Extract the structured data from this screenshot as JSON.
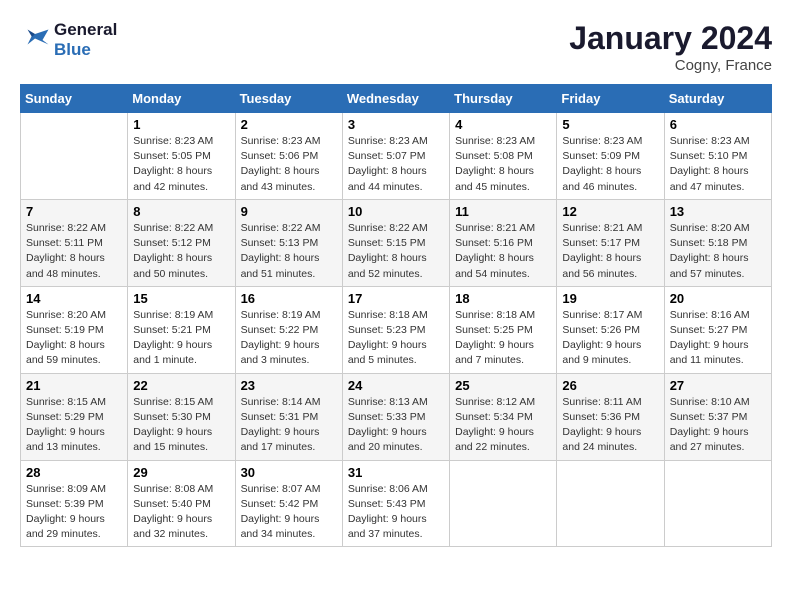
{
  "logo": {
    "text_general": "General",
    "text_blue": "Blue"
  },
  "title": "January 2024",
  "location": "Cogny, France",
  "days_of_week": [
    "Sunday",
    "Monday",
    "Tuesday",
    "Wednesday",
    "Thursday",
    "Friday",
    "Saturday"
  ],
  "weeks": [
    [
      {
        "day": null,
        "info": null
      },
      {
        "day": "1",
        "info": "Sunrise: 8:23 AM\nSunset: 5:05 PM\nDaylight: 8 hours\nand 42 minutes."
      },
      {
        "day": "2",
        "info": "Sunrise: 8:23 AM\nSunset: 5:06 PM\nDaylight: 8 hours\nand 43 minutes."
      },
      {
        "day": "3",
        "info": "Sunrise: 8:23 AM\nSunset: 5:07 PM\nDaylight: 8 hours\nand 44 minutes."
      },
      {
        "day": "4",
        "info": "Sunrise: 8:23 AM\nSunset: 5:08 PM\nDaylight: 8 hours\nand 45 minutes."
      },
      {
        "day": "5",
        "info": "Sunrise: 8:23 AM\nSunset: 5:09 PM\nDaylight: 8 hours\nand 46 minutes."
      },
      {
        "day": "6",
        "info": "Sunrise: 8:23 AM\nSunset: 5:10 PM\nDaylight: 8 hours\nand 47 minutes."
      }
    ],
    [
      {
        "day": "7",
        "info": "Sunrise: 8:22 AM\nSunset: 5:11 PM\nDaylight: 8 hours\nand 48 minutes."
      },
      {
        "day": "8",
        "info": "Sunrise: 8:22 AM\nSunset: 5:12 PM\nDaylight: 8 hours\nand 50 minutes."
      },
      {
        "day": "9",
        "info": "Sunrise: 8:22 AM\nSunset: 5:13 PM\nDaylight: 8 hours\nand 51 minutes."
      },
      {
        "day": "10",
        "info": "Sunrise: 8:22 AM\nSunset: 5:15 PM\nDaylight: 8 hours\nand 52 minutes."
      },
      {
        "day": "11",
        "info": "Sunrise: 8:21 AM\nSunset: 5:16 PM\nDaylight: 8 hours\nand 54 minutes."
      },
      {
        "day": "12",
        "info": "Sunrise: 8:21 AM\nSunset: 5:17 PM\nDaylight: 8 hours\nand 56 minutes."
      },
      {
        "day": "13",
        "info": "Sunrise: 8:20 AM\nSunset: 5:18 PM\nDaylight: 8 hours\nand 57 minutes."
      }
    ],
    [
      {
        "day": "14",
        "info": "Sunrise: 8:20 AM\nSunset: 5:19 PM\nDaylight: 8 hours\nand 59 minutes."
      },
      {
        "day": "15",
        "info": "Sunrise: 8:19 AM\nSunset: 5:21 PM\nDaylight: 9 hours\nand 1 minute."
      },
      {
        "day": "16",
        "info": "Sunrise: 8:19 AM\nSunset: 5:22 PM\nDaylight: 9 hours\nand 3 minutes."
      },
      {
        "day": "17",
        "info": "Sunrise: 8:18 AM\nSunset: 5:23 PM\nDaylight: 9 hours\nand 5 minutes."
      },
      {
        "day": "18",
        "info": "Sunrise: 8:18 AM\nSunset: 5:25 PM\nDaylight: 9 hours\nand 7 minutes."
      },
      {
        "day": "19",
        "info": "Sunrise: 8:17 AM\nSunset: 5:26 PM\nDaylight: 9 hours\nand 9 minutes."
      },
      {
        "day": "20",
        "info": "Sunrise: 8:16 AM\nSunset: 5:27 PM\nDaylight: 9 hours\nand 11 minutes."
      }
    ],
    [
      {
        "day": "21",
        "info": "Sunrise: 8:15 AM\nSunset: 5:29 PM\nDaylight: 9 hours\nand 13 minutes."
      },
      {
        "day": "22",
        "info": "Sunrise: 8:15 AM\nSunset: 5:30 PM\nDaylight: 9 hours\nand 15 minutes."
      },
      {
        "day": "23",
        "info": "Sunrise: 8:14 AM\nSunset: 5:31 PM\nDaylight: 9 hours\nand 17 minutes."
      },
      {
        "day": "24",
        "info": "Sunrise: 8:13 AM\nSunset: 5:33 PM\nDaylight: 9 hours\nand 20 minutes."
      },
      {
        "day": "25",
        "info": "Sunrise: 8:12 AM\nSunset: 5:34 PM\nDaylight: 9 hours\nand 22 minutes."
      },
      {
        "day": "26",
        "info": "Sunrise: 8:11 AM\nSunset: 5:36 PM\nDaylight: 9 hours\nand 24 minutes."
      },
      {
        "day": "27",
        "info": "Sunrise: 8:10 AM\nSunset: 5:37 PM\nDaylight: 9 hours\nand 27 minutes."
      }
    ],
    [
      {
        "day": "28",
        "info": "Sunrise: 8:09 AM\nSunset: 5:39 PM\nDaylight: 9 hours\nand 29 minutes."
      },
      {
        "day": "29",
        "info": "Sunrise: 8:08 AM\nSunset: 5:40 PM\nDaylight: 9 hours\nand 32 minutes."
      },
      {
        "day": "30",
        "info": "Sunrise: 8:07 AM\nSunset: 5:42 PM\nDaylight: 9 hours\nand 34 minutes."
      },
      {
        "day": "31",
        "info": "Sunrise: 8:06 AM\nSunset: 5:43 PM\nDaylight: 9 hours\nand 37 minutes."
      },
      {
        "day": null,
        "info": null
      },
      {
        "day": null,
        "info": null
      },
      {
        "day": null,
        "info": null
      }
    ]
  ]
}
